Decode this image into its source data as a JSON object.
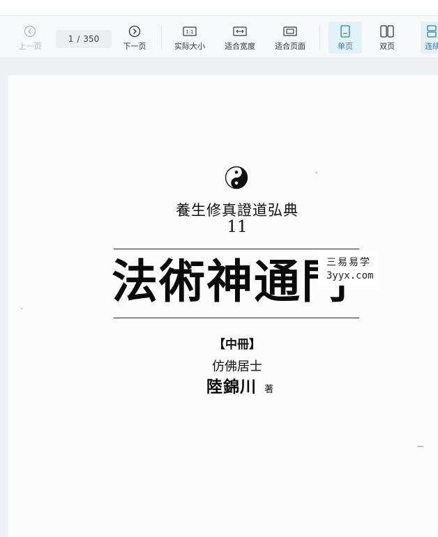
{
  "toolbar": {
    "prev_label": "上一页",
    "page_current": "1",
    "page_sep": "/",
    "page_total": "350",
    "next_label": "下一页",
    "actual_size_label": "实际大小",
    "actual_size_icon_text": "1:1",
    "fit_width_label": "适合宽度",
    "fit_page_label": "适合页面",
    "single_label": "单页",
    "double_label": "双页",
    "continuous_label": "连续"
  },
  "icons": {
    "prev": "chevron-left-circle-icon",
    "next": "chevron-right-circle-icon",
    "actual_size": "actual-size-icon",
    "fit_width": "fit-width-icon",
    "fit_page": "fit-page-icon",
    "single": "single-page-icon",
    "double": "double-page-icon",
    "continuous": "continuous-page-icon"
  },
  "colors": {
    "active_bg": "#e3f1f8",
    "active_text": "#2a7fb0",
    "disabled_text": "#b5b8bc"
  },
  "document": {
    "series_title": "養生修真證道弘典",
    "series_number": "11",
    "main_title": "法術神通門",
    "volume": "【中冊】",
    "pen_name": "仿佛居士",
    "author": "陸錦川",
    "author_suffix": "著",
    "watermark_line1": "三易易学",
    "watermark_line2": "3yyx.com"
  }
}
